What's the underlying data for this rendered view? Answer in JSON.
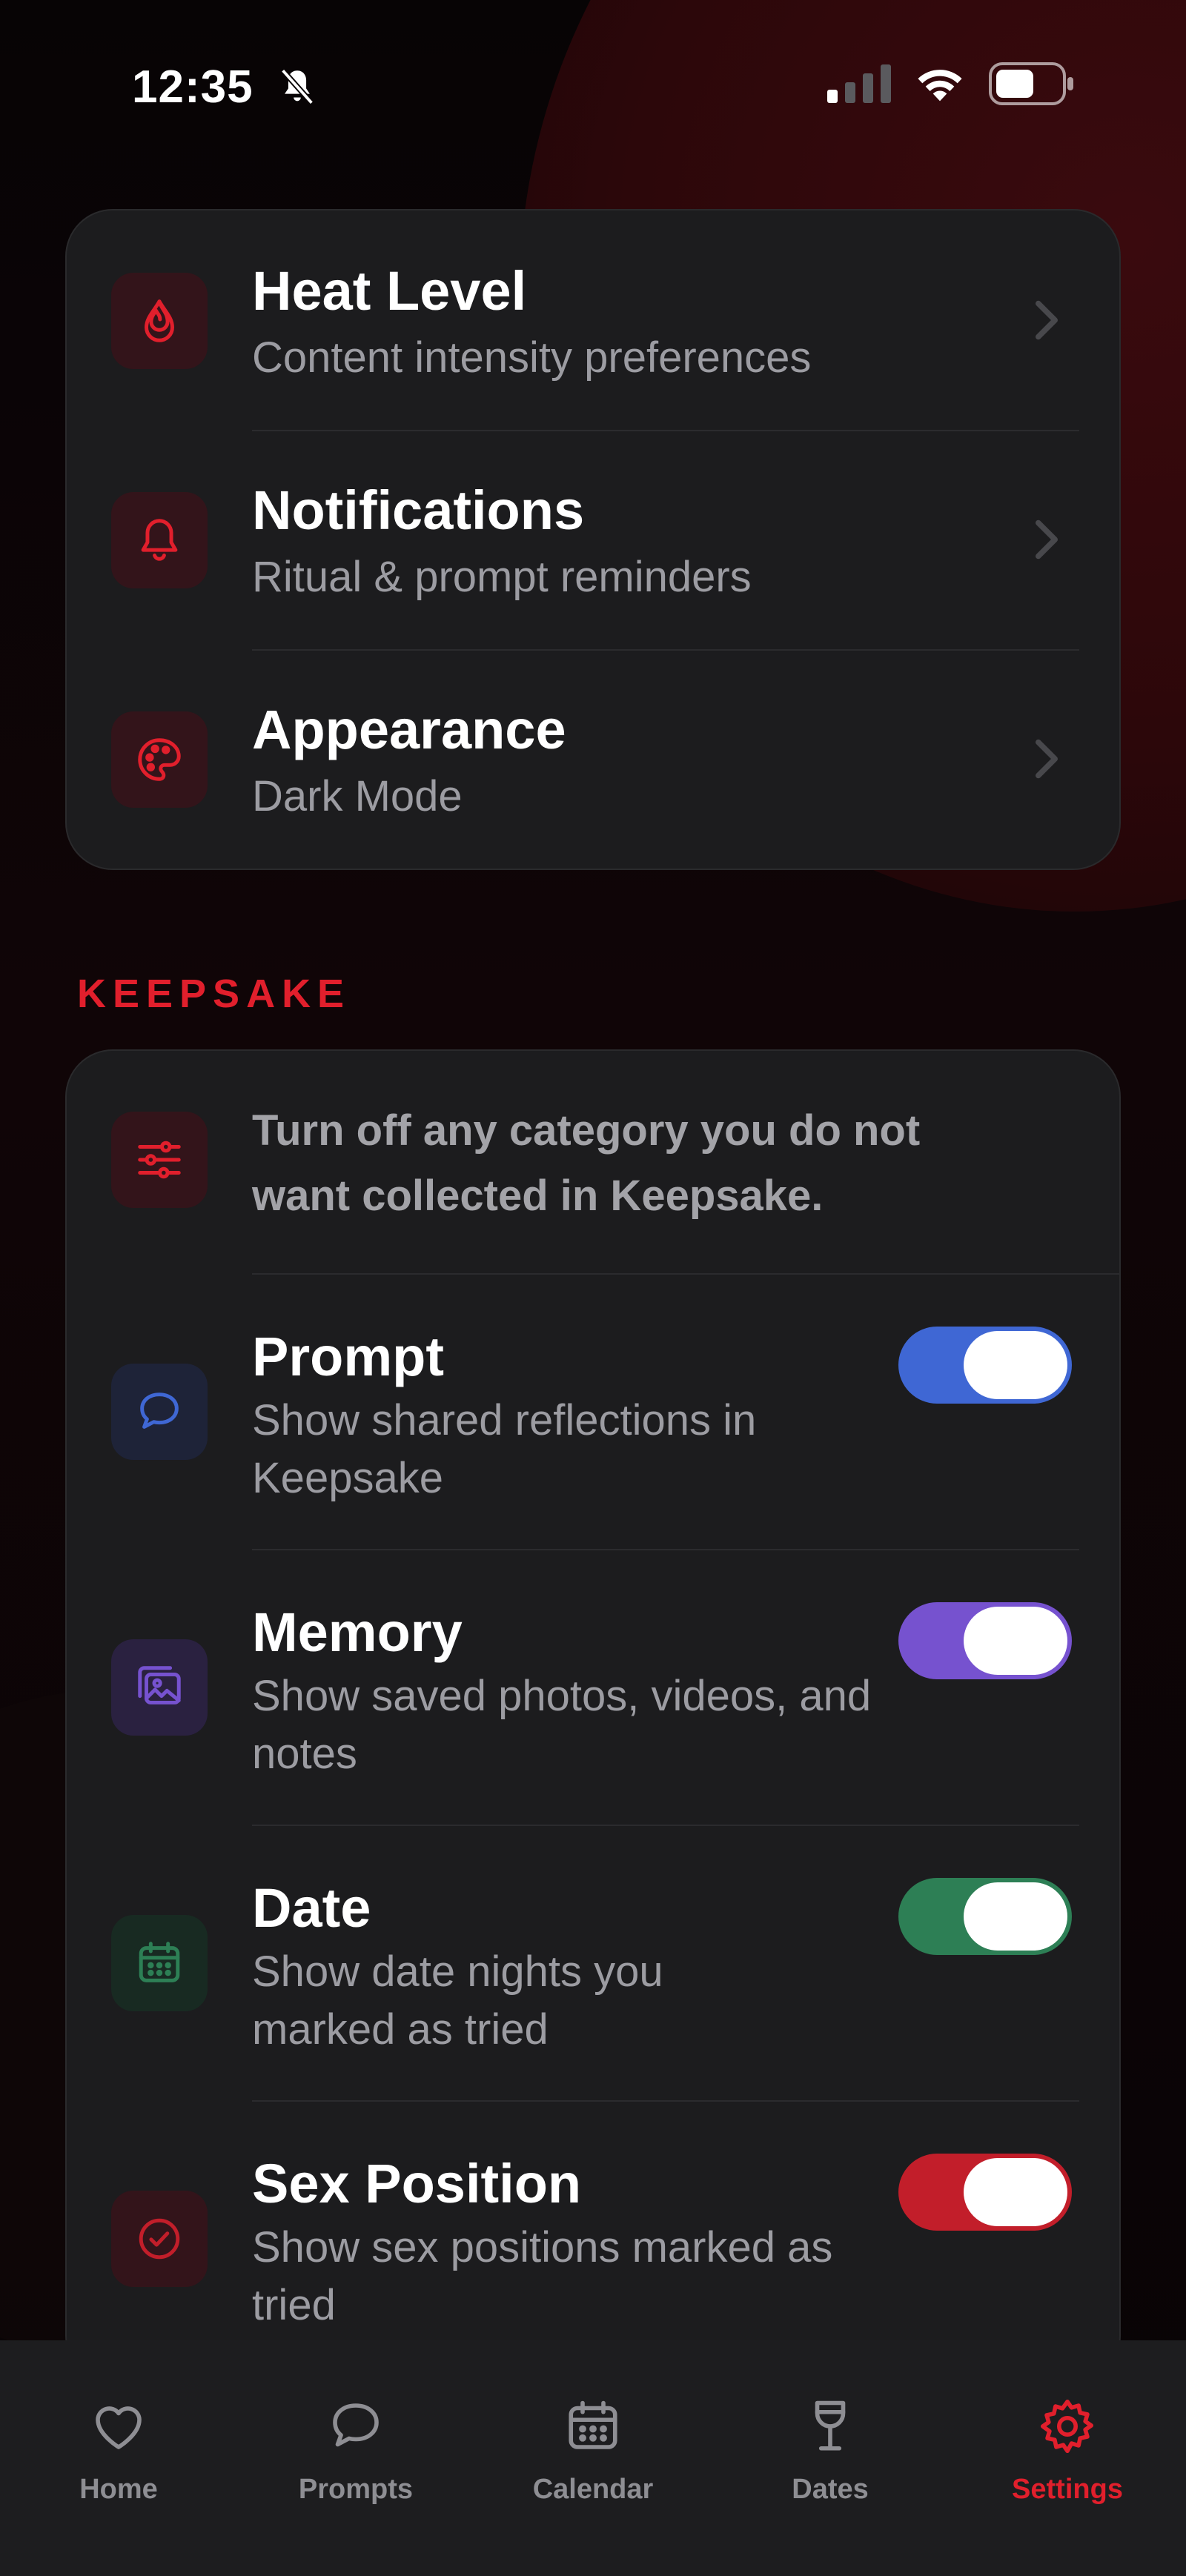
{
  "status_bar": {
    "time": "12:35"
  },
  "settings_card": {
    "rows": [
      {
        "title": "Heat Level",
        "subtitle": "Content intensity preferences",
        "icon": "flame-icon"
      },
      {
        "title": "Notifications",
        "subtitle": "Ritual & prompt reminders",
        "icon": "bell-icon"
      },
      {
        "title": "Appearance",
        "subtitle": "Dark Mode",
        "icon": "palette-icon"
      }
    ]
  },
  "keepsake": {
    "section_label": "KEEPSAKE",
    "intro": "Turn off any category you do not want collected in Keepsake.",
    "items": [
      {
        "title": "Prompt",
        "subtitle": "Show shared reflections in Keepsake",
        "enabled": true,
        "color": "#3f67d4",
        "icon": "chat-bubble-icon"
      },
      {
        "title": "Memory",
        "subtitle": "Show saved photos, videos, and notes",
        "enabled": true,
        "color": "#7652cf",
        "icon": "photos-icon"
      },
      {
        "title": "Date",
        "subtitle": "Show date nights you marked as tried",
        "enabled": true,
        "color": "#2d7f55",
        "icon": "calendar-icon"
      },
      {
        "title": "Sex Position",
        "subtitle": "Show sex positions marked as tried",
        "enabled": true,
        "color": "#c21e2a",
        "icon": "checkmark-circle-icon"
      }
    ]
  },
  "tab_bar": {
    "tabs": [
      {
        "label": "Home",
        "icon": "heart-icon",
        "active": false
      },
      {
        "label": "Prompts",
        "icon": "chat-bubble-icon",
        "active": false
      },
      {
        "label": "Calendar",
        "icon": "calendar-icon",
        "active": false
      },
      {
        "label": "Dates",
        "icon": "wine-glass-icon",
        "active": false
      },
      {
        "label": "Settings",
        "icon": "gear-icon",
        "active": true
      }
    ]
  },
  "colors": {
    "accent": "#e11f2c",
    "card": "#1c1c1e",
    "subtitle": "#9c9ca2"
  }
}
